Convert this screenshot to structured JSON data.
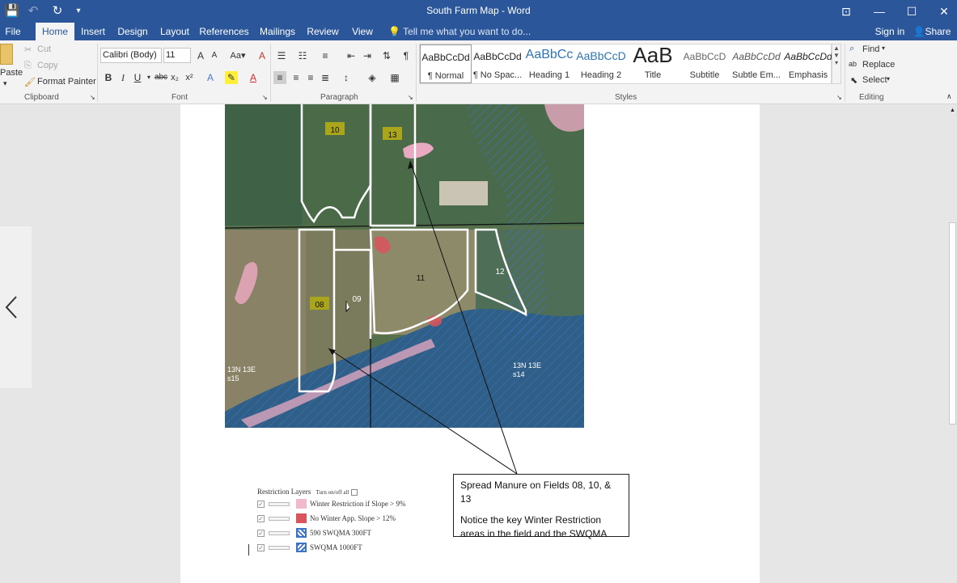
{
  "window": {
    "title": "South Farm Map - Word",
    "controls": {
      "ribbon_display": "⊡",
      "minimize": "—",
      "maximize": "☐",
      "close": "✕"
    }
  },
  "qat": {
    "save": "💾",
    "undo": "↶",
    "redo": "↻",
    "customize": "▾"
  },
  "tabs": [
    "File",
    "Home",
    "Insert",
    "Design",
    "Layout",
    "References",
    "Mailings",
    "Review",
    "View"
  ],
  "tell_me": "Tell me what you want to do...",
  "account": {
    "sign_in": "Sign in",
    "share": "Share"
  },
  "clipboard": {
    "paste": "Paste",
    "cut": "Cut",
    "copy": "Copy",
    "format_painter": "Format Painter",
    "label": "Clipboard"
  },
  "font": {
    "name": "Calibri (Body)",
    "size": "11",
    "label": "Font"
  },
  "paragraph": {
    "label": "Paragraph"
  },
  "styles": {
    "label": "Styles",
    "items": [
      {
        "preview": "AaBbCcDd",
        "name": "¶ Normal"
      },
      {
        "preview": "AaBbCcDd",
        "name": "¶ No Spac..."
      },
      {
        "preview": "AaBbCc",
        "name": "Heading 1"
      },
      {
        "preview": "AaBbCcD",
        "name": "Heading 2"
      },
      {
        "preview": "AaB",
        "name": "Title"
      },
      {
        "preview": "AaBbCcD",
        "name": "Subtitle"
      },
      {
        "preview": "AaBbCcDd",
        "name": "Subtle Em..."
      },
      {
        "preview": "AaBbCcDd",
        "name": "Emphasis"
      }
    ]
  },
  "editing": {
    "find": "Find",
    "replace": "Replace",
    "select": "Select",
    "label": "Editing"
  },
  "map": {
    "fields": [
      "10",
      "13",
      "12",
      "11",
      "08",
      "09"
    ],
    "sections": [
      "13N 13E",
      "s15",
      "13N 13E",
      "s14"
    ]
  },
  "callout": {
    "line1": "Spread Manure on Fields 08, 10, & 13",
    "line2": "Notice the key Winter Restriction areas in the field and the SWQMA"
  },
  "legend": {
    "title": "Restriction Layers",
    "toggle_all": "Turn on/off all",
    "items": [
      {
        "label": "Winter Restriction if Slope > 9%",
        "color": "#f2b9cc"
      },
      {
        "label": "No Winter App. Slope > 12%",
        "color": "#d9545d"
      },
      {
        "label": "590 SWQMA 300FT",
        "color": "#3b73c8"
      },
      {
        "label": "SWQMA 1000FT",
        "color": "#3b73c8"
      }
    ]
  },
  "colors": {
    "accent": "#2b579a",
    "restriction_pink": "#f2b9cc",
    "restriction_red": "#d9545d",
    "swqma_blue": "#3b73c8"
  }
}
